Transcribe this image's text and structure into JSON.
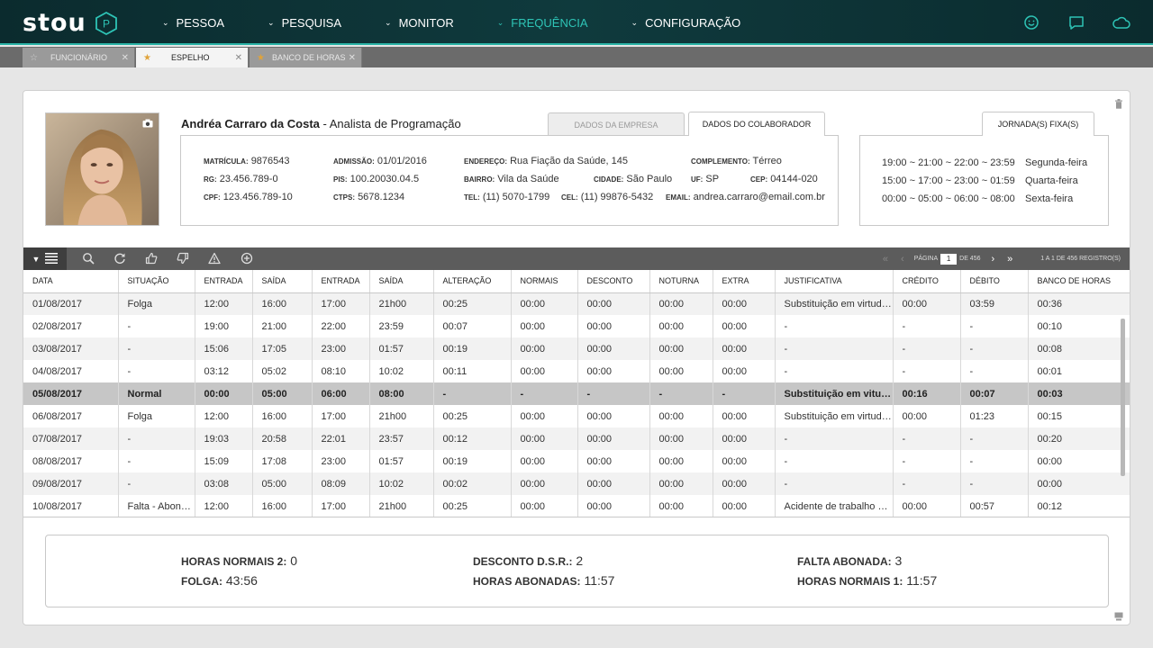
{
  "brand": {
    "name": "stou",
    "mark": "P"
  },
  "nav": {
    "items": [
      {
        "label": "PESSOA",
        "active": false
      },
      {
        "label": "PESQUISA",
        "active": false
      },
      {
        "label": "MONITOR",
        "active": false
      },
      {
        "label": "FREQUÊNCIA",
        "active": true
      },
      {
        "label": "CONFIGURAÇÃO",
        "active": false
      }
    ],
    "right_icons": [
      "smiley-icon",
      "chat-icon",
      "cloud-icon"
    ]
  },
  "tabs": [
    {
      "label": "FUNCIONÁRIO",
      "starred": false,
      "active": false
    },
    {
      "label": "ESPELHO",
      "starred": true,
      "active": true
    },
    {
      "label": "BANCO DE HORAS",
      "starred": true,
      "active": false
    }
  ],
  "employee": {
    "name": "Andréa Carraro da Costa",
    "role_separator": " - ",
    "role": "Analista de Programação"
  },
  "info_tabs": {
    "company": "DADOS DA EMPRESA",
    "employee": "DADOS DO COLABORADOR"
  },
  "fields": {
    "matricula": {
      "label": "MATRÍCULA:",
      "value": "9876543"
    },
    "rg": {
      "label": "RG:",
      "value": "23.456.789-0"
    },
    "cpf": {
      "label": "CPF:",
      "value": "123.456.789-10"
    },
    "admissao": {
      "label": "ADMISSÃO:",
      "value": "01/01/2016"
    },
    "pis": {
      "label": "PIS:",
      "value": "100.20030.04.5"
    },
    "ctps": {
      "label": "CTPS:",
      "value": "5678.1234"
    },
    "endereco": {
      "label": "ENDEREÇO:",
      "value": "Rua Fiação da Saúde, 145"
    },
    "bairro": {
      "label": "BAIRRO:",
      "value": "Vila da Saúde"
    },
    "tel": {
      "label": "TEL:",
      "value": "(11) 5070-1799"
    },
    "cidade": {
      "label": "CIDADE:",
      "value": "São Paulo"
    },
    "cel": {
      "label": "CEL:",
      "value": "(11) 99876-5432"
    },
    "complemento": {
      "label": "COMPLEMENTO:",
      "value": "Térreo"
    },
    "uf": {
      "label": "UF:",
      "value": "SP"
    },
    "cep": {
      "label": "CEP:",
      "value": "04144-020"
    },
    "email": {
      "label": "EMAIL:",
      "value": "andrea.carraro@email.com.br"
    }
  },
  "jornada": {
    "tab_label": "JORNADA(S) FIXA(S)",
    "rows": [
      {
        "hours": "19:00 ~ 21:00 ~ 22:00 ~ 23:59",
        "day": "Segunda-feira"
      },
      {
        "hours": "15:00 ~ 17:00 ~ 23:00 ~ 01:59",
        "day": "Quarta-feira"
      },
      {
        "hours": "00:00 ~ 05:00 ~ 06:00 ~ 08:00",
        "day": "Sexta-feira"
      }
    ]
  },
  "pager": {
    "page_label": "PÁGINA",
    "page": "1",
    "of_label": "DE 456",
    "records": "1 A 1 DE 456 REGISTRO(S)"
  },
  "table": {
    "columns": [
      "DATA",
      "SITUAÇÃO",
      "ENTRADA",
      "SAÍDA",
      "ENTRADA",
      "SAÍDA",
      "ALTERAÇÃO",
      "NORMAIS",
      "DESCONTO",
      "NOTURNA",
      "EXTRA",
      "JUSTIFICATIVA",
      "CRÉDITO",
      "DÉBITO",
      "BANCO DE HORAS"
    ],
    "rows": [
      [
        "01/08/2017",
        "Folga",
        "12:00",
        "16:00",
        "17:00",
        "21h00",
        "00:25",
        "00:00",
        "00:00",
        "00:00",
        "00:00",
        "Substituição em virtude...",
        "00:00",
        "03:59",
        "00:36"
      ],
      [
        "02/08/2017",
        "-",
        "19:00",
        "21:00",
        "22:00",
        "23:59",
        "00:07",
        "00:00",
        "00:00",
        "00:00",
        "00:00",
        "-",
        "-",
        "-",
        "00:10"
      ],
      [
        "03/08/2017",
        "-",
        "15:06",
        "17:05",
        "23:00",
        "01:57",
        "00:19",
        "00:00",
        "00:00",
        "00:00",
        "00:00",
        "-",
        "-",
        "-",
        "00:08"
      ],
      [
        "04/08/2017",
        "-",
        "03:12",
        "05:02",
        "08:10",
        "10:02",
        "00:11",
        "00:00",
        "00:00",
        "00:00",
        "00:00",
        "-",
        "-",
        "-",
        "00:01"
      ],
      [
        "05/08/2017",
        "Normal",
        "00:00",
        "05:00",
        "06:00",
        "08:00",
        "-",
        "-",
        "-",
        "-",
        "-",
        "Substituição em vitude ...",
        "00:16",
        "00:07",
        "00:03"
      ],
      [
        "06/08/2017",
        "Folga",
        "12:00",
        "16:00",
        "17:00",
        "21h00",
        "00:25",
        "00:00",
        "00:00",
        "00:00",
        "00:00",
        "Substituição em virtude...",
        "00:00",
        "01:23",
        "00:15"
      ],
      [
        "07/08/2017",
        "-",
        "19:03",
        "20:58",
        "22:01",
        "23:57",
        "00:12",
        "00:00",
        "00:00",
        "00:00",
        "00:00",
        "-",
        "-",
        "-",
        "00:20"
      ],
      [
        "08/08/2017",
        "-",
        "15:09",
        "17:08",
        "23:00",
        "01:57",
        "00:19",
        "00:00",
        "00:00",
        "00:00",
        "00:00",
        "-",
        "-",
        "-",
        "00:00"
      ],
      [
        "09/08/2017",
        "-",
        "03:08",
        "05:00",
        "08:09",
        "10:02",
        "00:02",
        "00:00",
        "00:00",
        "00:00",
        "00:00",
        "-",
        "-",
        "-",
        "00:00"
      ],
      [
        "10/08/2017",
        "Falta - Abonada",
        "12:00",
        "16:00",
        "17:00",
        "21h00",
        "00:25",
        "00:00",
        "00:00",
        "00:00",
        "00:00",
        "Acidente de trabalho pe...",
        "00:00",
        "00:57",
        "00:12"
      ]
    ],
    "highlight_row": 4
  },
  "summary": {
    "horas_normais_2": {
      "label": "HORAS NORMAIS 2:",
      "value": "0"
    },
    "folga": {
      "label": "FOLGA:",
      "value": "43:56"
    },
    "desconto_dsr": {
      "label": "DESCONTO D.S.R.:",
      "value": "2"
    },
    "horas_abonadas": {
      "label": "HORAS ABONADAS:",
      "value": "11:57"
    },
    "falta_abonada": {
      "label": "FALTA ABONADA:",
      "value": "3"
    },
    "horas_normais_1": {
      "label": "HORAS NORMAIS 1:",
      "value": "11:57"
    }
  },
  "colors": {
    "accent": "#2ec4b6",
    "topbar": "#0f3a3d",
    "highlight_row": "#c6c6c6"
  }
}
